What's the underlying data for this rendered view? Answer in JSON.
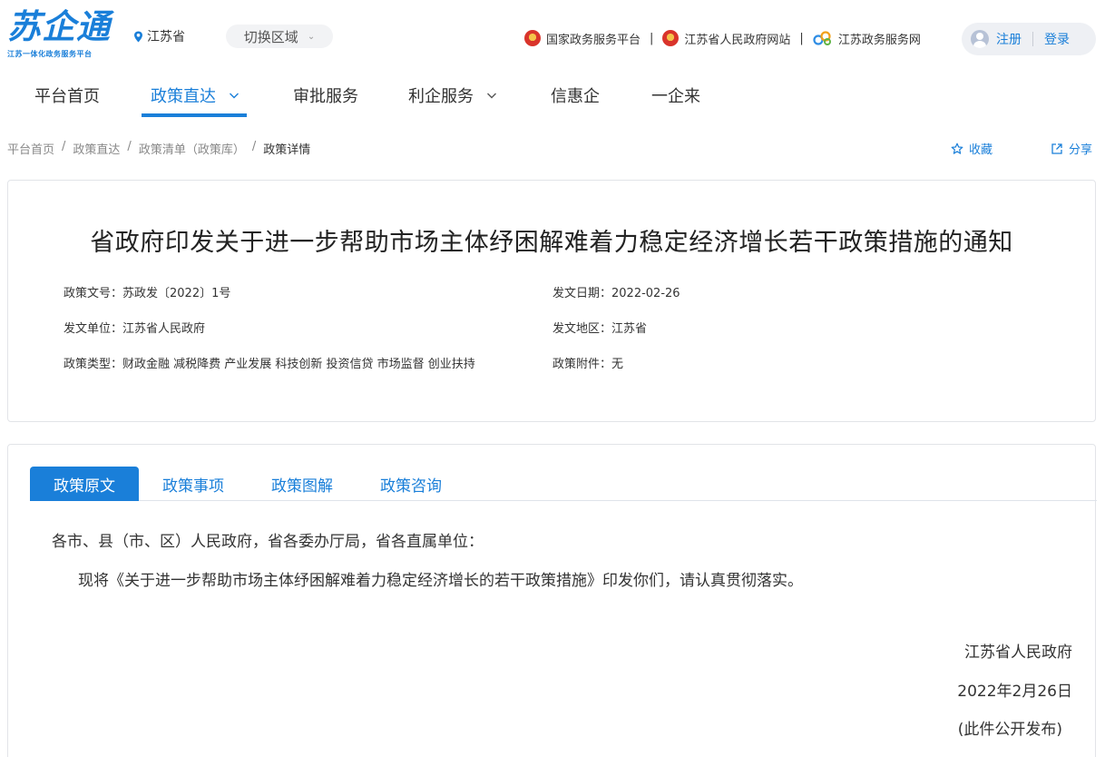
{
  "header": {
    "logo_text": "苏企通",
    "logo_sub": "江苏一体化政务服务平台",
    "region": "江苏省",
    "switch_region": "切换区域",
    "links": [
      "国家政务服务平台",
      "江苏省人民政府网站",
      "江苏政务服务网"
    ],
    "register": "注册",
    "login": "登录"
  },
  "nav": {
    "items": [
      "平台首页",
      "政策直达",
      "审批服务",
      "利企服务",
      "信惠企",
      "一企来"
    ],
    "active": "政策直达"
  },
  "breadcrumb": {
    "items": [
      "平台首页",
      "政策直达",
      "政策清单（政策库）",
      "政策详情"
    ],
    "favorite": "收藏",
    "share": "分享"
  },
  "policy": {
    "title": "省政府印发关于进一步帮助市场主体纾困解难着力稳定经济增长若干政策措施的通知",
    "doc_no_label": "政策文号：",
    "doc_no": "苏政发〔2022〕1号",
    "date_label": "发文日期：",
    "date": "2022-02-26",
    "issuer_label": "发文单位：",
    "issuer": "江苏省人民政府",
    "area_label": "发文地区：",
    "area": "江苏省",
    "type_label": "政策类型：",
    "type": "财政金融 减税降费 产业发展 科技创新 投资信贷 市场监督 创业扶持",
    "attach_label": "政策附件：",
    "attach": "无"
  },
  "tabs": [
    "政策原文",
    "政策事项",
    "政策图解",
    "政策咨询"
  ],
  "content": {
    "salutation": "各市、县（市、区）人民政府，省各委办厅局，省各直属单位：",
    "paragraph": "现将《关于进一步帮助市场主体纾困解难着力稳定经济增长的若干政策措施》印发你们，请认真贯彻落实。",
    "signature": "江苏省人民政府",
    "sign_date": "2022年2月26日",
    "note": "(此件公开发布)"
  },
  "colors": {
    "brand": "#1a7fd9"
  }
}
